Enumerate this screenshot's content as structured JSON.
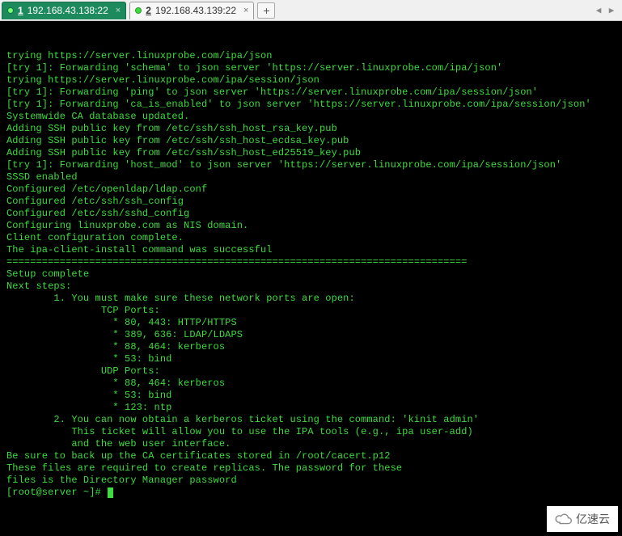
{
  "tabs": [
    {
      "num": "1",
      "label": "192.168.43.138:22",
      "active": true
    },
    {
      "num": "2",
      "label": "192.168.43.139:22",
      "active": false
    }
  ],
  "new_tab_symbol": "+",
  "nav_left": "◀",
  "nav_right": "▶",
  "terminal_lines": [
    "trying https://server.linuxprobe.com/ipa/json",
    "[try 1]: Forwarding 'schema' to json server 'https://server.linuxprobe.com/ipa/json'",
    "trying https://server.linuxprobe.com/ipa/session/json",
    "[try 1]: Forwarding 'ping' to json server 'https://server.linuxprobe.com/ipa/session/json'",
    "[try 1]: Forwarding 'ca_is_enabled' to json server 'https://server.linuxprobe.com/ipa/session/json'",
    "Systemwide CA database updated.",
    "Adding SSH public key from /etc/ssh/ssh_host_rsa_key.pub",
    "Adding SSH public key from /etc/ssh/ssh_host_ecdsa_key.pub",
    "Adding SSH public key from /etc/ssh/ssh_host_ed25519_key.pub",
    "[try 1]: Forwarding 'host_mod' to json server 'https://server.linuxprobe.com/ipa/session/json'",
    "SSSD enabled",
    "Configured /etc/openldap/ldap.conf",
    "Configured /etc/ssh/ssh_config",
    "Configured /etc/ssh/sshd_config",
    "Configuring linuxprobe.com as NIS domain.",
    "Client configuration complete.",
    "The ipa-client-install command was successful",
    "",
    "==============================================================================",
    "Setup complete",
    "",
    "Next steps:",
    "        1. You must make sure these network ports are open:",
    "                TCP Ports:",
    "                  * 80, 443: HTTP/HTTPS",
    "                  * 389, 636: LDAP/LDAPS",
    "                  * 88, 464: kerberos",
    "                  * 53: bind",
    "                UDP Ports:",
    "                  * 88, 464: kerberos",
    "                  * 53: bind",
    "                  * 123: ntp",
    "",
    "        2. You can now obtain a kerberos ticket using the command: 'kinit admin'",
    "           This ticket will allow you to use the IPA tools (e.g., ipa user-add)",
    "           and the web user interface.",
    "",
    "Be sure to back up the CA certificates stored in /root/cacert.p12",
    "These files are required to create replicas. The password for these",
    "files is the Directory Manager password"
  ],
  "prompt": "[root@server ~]# ",
  "watermark_text": "亿速云"
}
